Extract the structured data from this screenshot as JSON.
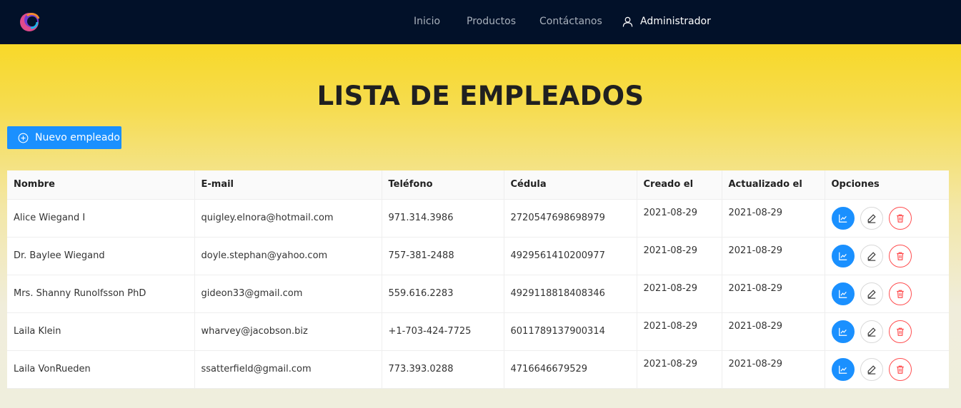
{
  "nav": {
    "links": [
      "Inicio",
      "Productos",
      "Contáctanos"
    ],
    "user": "Administrador"
  },
  "page": {
    "title": "LISTA DE EMPLEADOS",
    "new_button": "Nuevo empleado"
  },
  "table": {
    "headers": [
      "Nombre",
      "E-mail",
      "Teléfono",
      "Cédula",
      "Creado el",
      "Actualizado el",
      "Opciones"
    ],
    "rows": [
      [
        "Alice Wiegand I",
        "quigley.elnora@hotmail.com",
        "971.314.3986",
        "2720547698698979",
        "2021-08-29",
        "2021-08-29"
      ],
      [
        "Dr. Baylee Wiegand",
        "doyle.stephan@yahoo.com",
        "757-381-2488",
        "4929561410200977",
        "2021-08-29",
        "2021-08-29"
      ],
      [
        "Mrs. Shanny Runolfsson PhD",
        "gideon33@gmail.com",
        "559.616.2283",
        "4929118818408346",
        "2021-08-29",
        "2021-08-29"
      ],
      [
        "Laila Klein",
        "wharvey@jacobson.biz",
        "+1-703-424-7725",
        "6011789137900314",
        "2021-08-29",
        "2021-08-29"
      ],
      [
        "Laila VonRueden",
        "ssatterfield@gmail.com",
        "773.393.0288",
        "4716646679529",
        "2021-08-29",
        "2021-08-29"
      ]
    ],
    "row_actions": [
      "line-chart-icon",
      "edit-pencil-icon",
      "trash-icon"
    ]
  },
  "colors": {
    "navbar": "#021129",
    "primary": "#1a90ff",
    "danger": "#ff4d4f",
    "gradient_top": "#f9d60e",
    "gradient_bottom": "#efeedd"
  }
}
